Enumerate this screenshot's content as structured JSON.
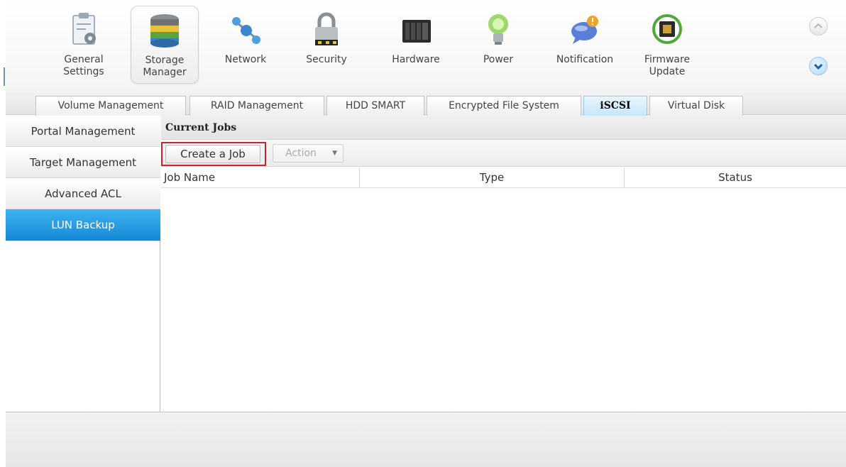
{
  "toolbar": {
    "items": [
      {
        "label": "General\nSettings",
        "icon": "general-settings-icon"
      },
      {
        "label": "Storage\nManager",
        "icon": "storage-manager-icon",
        "selected": true
      },
      {
        "label": "Network",
        "icon": "network-icon"
      },
      {
        "label": "Security",
        "icon": "padlock-icon"
      },
      {
        "label": "Hardware",
        "icon": "hardware-icon"
      },
      {
        "label": "Power",
        "icon": "lightbulb-icon"
      },
      {
        "label": "Notification",
        "icon": "notification-icon"
      },
      {
        "label": "Firmware\nUpdate",
        "icon": "firmware-chip-icon"
      }
    ]
  },
  "tabs": [
    {
      "label": "Volume Management"
    },
    {
      "label": "RAID Management"
    },
    {
      "label": "HDD SMART"
    },
    {
      "label": "Encrypted File System"
    },
    {
      "label": "iSCSI",
      "active": true
    },
    {
      "label": "Virtual Disk"
    }
  ],
  "sidenav": {
    "items": [
      {
        "label": "Portal Management"
      },
      {
        "label": "Target Management"
      },
      {
        "label": "Advanced ACL"
      },
      {
        "label": "LUN Backup",
        "active": true
      }
    ]
  },
  "content": {
    "section_title": "Current Jobs",
    "create_button": "Create a Job",
    "action_button": "Action",
    "columns": [
      "Job Name",
      "Type",
      "Status"
    ],
    "rows": []
  },
  "colors": {
    "active_blue": "#1d95e0",
    "highlight_red": "#c0262d",
    "tab_active_bg": "#c7e6fb"
  }
}
